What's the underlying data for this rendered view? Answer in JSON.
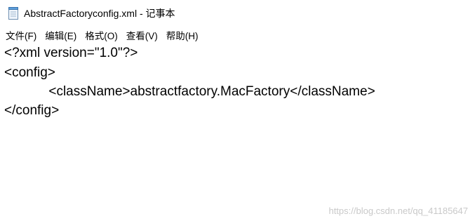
{
  "window": {
    "title": "AbstractFactoryconfig.xml - 记事本",
    "icon": "notepad-icon"
  },
  "menu": {
    "items": [
      "文件(F)",
      "编辑(E)",
      "格式(O)",
      "查看(V)",
      "帮助(H)"
    ]
  },
  "editor": {
    "lines": [
      "<?xml version=\"1.0\"?>",
      "<config>",
      "\t\t<className>abstractfactory.MacFactory</className>",
      "</config>"
    ]
  },
  "watermark": {
    "text": "https://blog.csdn.net/qq_41185647"
  }
}
